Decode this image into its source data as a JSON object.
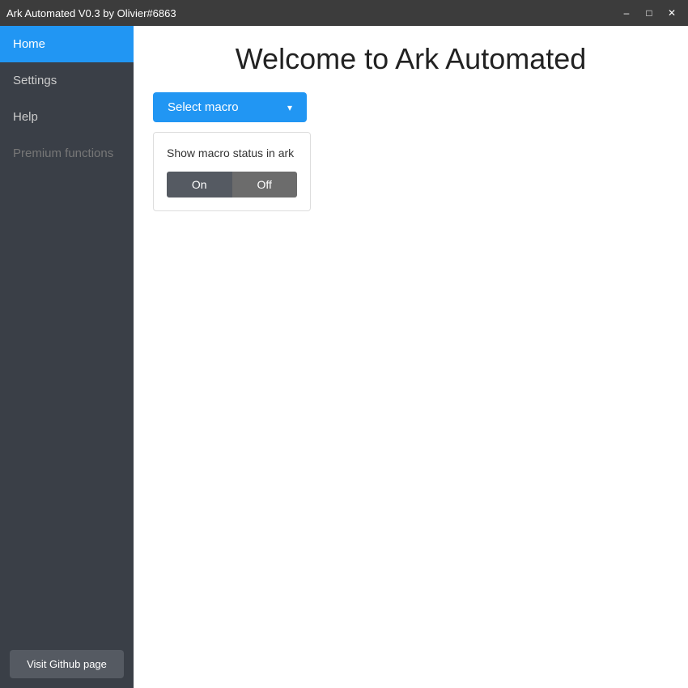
{
  "titlebar": {
    "title": "Ark Automated V0.3 by Olivier#6863",
    "minimize_label": "–",
    "maximize_label": "□",
    "close_label": "✕"
  },
  "sidebar": {
    "items": [
      {
        "id": "home",
        "label": "Home",
        "active": true,
        "disabled": false
      },
      {
        "id": "settings",
        "label": "Settings",
        "active": false,
        "disabled": false
      },
      {
        "id": "help",
        "label": "Help",
        "active": false,
        "disabled": false
      },
      {
        "id": "premium",
        "label": "Premium functions",
        "active": false,
        "disabled": true
      }
    ],
    "footer": {
      "github_btn_label": "Visit Github page"
    }
  },
  "content": {
    "page_title": "Welcome to Ark Automated",
    "select_macro_btn": "Select macro",
    "macro_card": {
      "label": "Show macro status in ark",
      "toggle_on": "On",
      "toggle_off": "Off"
    }
  }
}
